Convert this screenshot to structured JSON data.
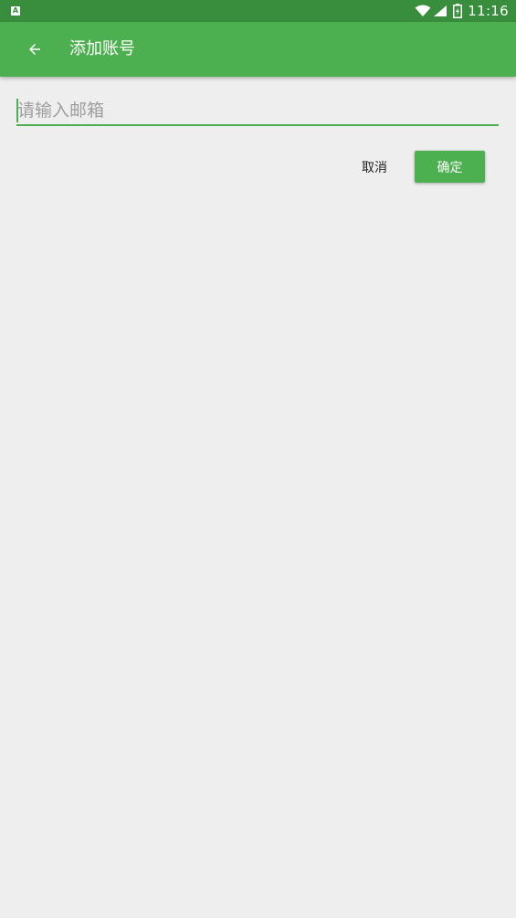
{
  "status_bar": {
    "time": "11:16",
    "notification_icon": "A",
    "icons": [
      "notification-icon",
      "wifi-icon",
      "signal-icon",
      "battery-icon"
    ]
  },
  "toolbar": {
    "title": "添加账号",
    "back_icon": "arrow-back-icon"
  },
  "form": {
    "email_placeholder": "请输入邮箱",
    "email_value": ""
  },
  "actions": {
    "cancel_label": "取消",
    "confirm_label": "确定"
  },
  "colors": {
    "status_bar": "#388e3c",
    "toolbar": "#4caf50",
    "accent": "#4caf50",
    "background": "#eeeeee"
  }
}
